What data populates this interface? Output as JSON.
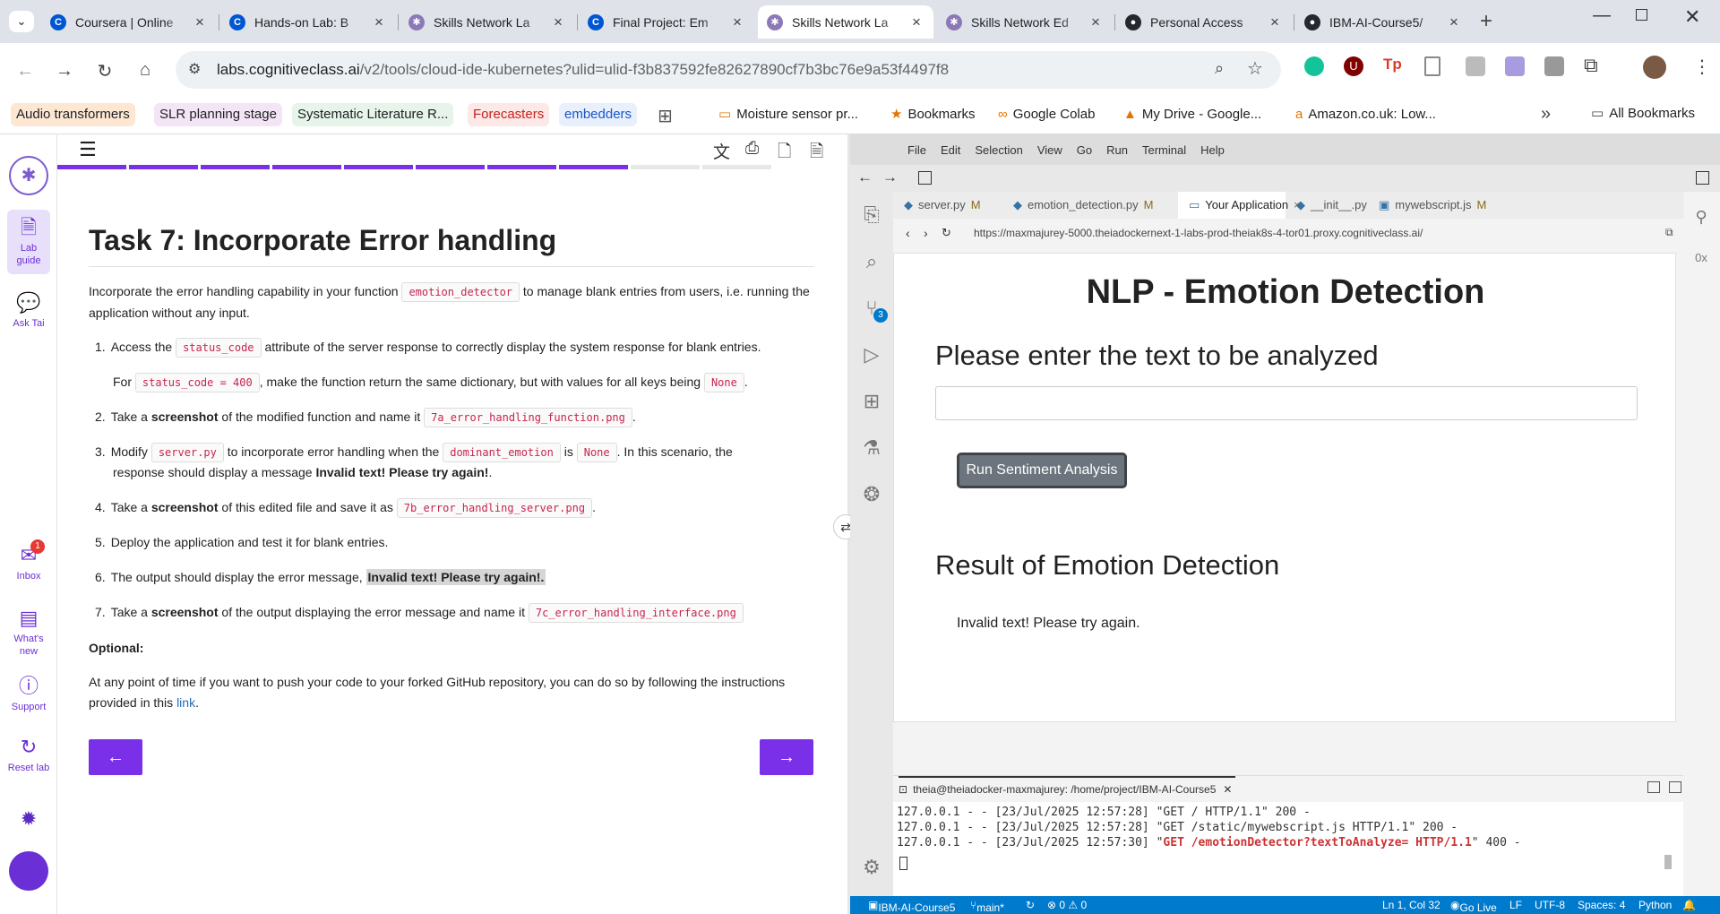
{
  "browser": {
    "tabs": [
      {
        "title": "Coursera | Online",
        "fav": "C",
        "color": "#0056d2"
      },
      {
        "title": "Hands-on Lab: B",
        "fav": "C",
        "color": "#0056d2"
      },
      {
        "title": "Skills Network La",
        "fav": "✱",
        "color": "#8c7ab8"
      },
      {
        "title": "Final Project: Em",
        "fav": "C",
        "color": "#0056d2"
      },
      {
        "title": "Skills Network La",
        "fav": "✱",
        "color": "#8c7ab8"
      },
      {
        "title": "Skills Network Ed",
        "fav": "✱",
        "color": "#8c7ab8"
      },
      {
        "title": "Personal Access",
        "fav": "●",
        "color": "#24292e"
      },
      {
        "title": "IBM-AI-Course5/",
        "fav": "●",
        "color": "#24292e"
      }
    ],
    "new_tab": "+",
    "url_host": "labs.cognitiveclass.ai",
    "url_path": "/v2/tools/cloud-ide-kubernetes?ulid=ulid-f3b837592fe82627890cf7b3bc76e9a53f4497f8",
    "bookmarks_chips": [
      {
        "label": "Audio transformers",
        "bg": "#fde7d3",
        "fg": "#202124"
      },
      {
        "label": "SLR planning stage",
        "bg": "#f3e5f5",
        "fg": "#202124"
      },
      {
        "label": "Systematic Literature R...",
        "bg": "#e6f4ea",
        "fg": "#202124"
      },
      {
        "label": "Forecasters",
        "bg": "#fce8e6",
        "fg": "#c5221f"
      },
      {
        "label": "embedders",
        "bg": "#e8f0fe",
        "fg": "#1a56c2"
      }
    ],
    "bookmarks_plain": [
      "Moisture sensor pr...",
      "Bookmarks",
      "Google Colab",
      "My Drive - Google...",
      "Amazon.co.uk: Low..."
    ],
    "all_bookmarks": "All Bookmarks",
    "more": "»"
  },
  "labside": {
    "lab_guide": "Lab guide",
    "ask_tai": "Ask Tai",
    "inbox": "Inbox",
    "inbox_badge": "1",
    "whats_new": "What's new",
    "support": "Support",
    "reset_lab": "Reset lab"
  },
  "guide": {
    "progress_done": 8,
    "progress_total": 10,
    "title": "Task 7: Incorporate Error handling",
    "intro_a": "Incorporate the error handling capability in your function",
    "intro_code": "emotion_detector",
    "intro_b": "to manage blank entries from users, i.e. running the application without any input.",
    "s1_num": "1.",
    "s1_a": "Access the",
    "s1_code": "status_code",
    "s1_b": "attribute of the server response to correctly display the system response for blank entries.",
    "s1_c": "For",
    "s1_code2": "status_code = 400",
    "s1_d": ", make the function return the same dictionary, but with values for all keys being",
    "s1_code3": "None",
    "s2_num": "2.",
    "s2_a": "Take a",
    "s2_bold": "screenshot",
    "s2_b": "of the modified function and name it",
    "s2_code": "7a_error_handling_function.png",
    "s3_num": "3.",
    "s3_a": "Modify",
    "s3_code": "server.py",
    "s3_b": "to incorporate error handling when the",
    "s3_code2": "dominant_emotion",
    "s3_c": "is",
    "s3_code3": "None",
    "s3_d": ". In this scenario, the",
    "s3_e": "response should display a message",
    "s3_bold": "Invalid text! Please try again!",
    "s4_num": "4.",
    "s4_a": "Take a",
    "s4_bold": "screenshot",
    "s4_b": "of this edited file and save it as",
    "s4_code": "7b_error_handling_server.png",
    "s5_num": "5.",
    "s5_a": "Deploy the application and test it for blank entries.",
    "s6_num": "6.",
    "s6_a": "The output should display the error message,",
    "s6_hl": "Invalid text! Please try again!.",
    "s7_num": "7.",
    "s7_a": "Take a",
    "s7_bold": "screenshot",
    "s7_b": "of the output displaying the error message and name it",
    "s7_code": "7c_error_handling_interface.png",
    "optional": "Optional:",
    "opt_a": "At any point of time if you want to push your code to your forked GitHub repository, you can do so by following the instructions",
    "opt_b": "provided in this",
    "opt_link": "link",
    "prev": "←",
    "next": "→"
  },
  "ide": {
    "menu": [
      "File",
      "Edit",
      "Selection",
      "View",
      "Go",
      "Run",
      "Terminal",
      "Help"
    ],
    "scm_badge": "3",
    "tabs": [
      {
        "label": "server.py",
        "mod": "M"
      },
      {
        "label": "emotion_detection.py",
        "mod": "M"
      },
      {
        "label": "Your Application",
        "mod": "×"
      },
      {
        "label": "__init__.py",
        "mod": ""
      },
      {
        "label": "mywebscript.js",
        "mod": "M"
      }
    ],
    "preview_url": "https://maxmajurey-5000.theiadockernext-1-labs-prod-theiak8s-4-tor01.proxy.cognitiveclass.ai/",
    "app": {
      "h1": "NLP - Emotion Detection",
      "h2": "Please enter the text to be analyzed",
      "button": "Run Sentiment Analysis",
      "h3": "Result of Emotion Detection",
      "result": "Invalid text! Please try again."
    },
    "terminal_tab": "theia@theiadocker-maxmajurey: /home/project/IBM-AI-Course5",
    "terminal": [
      {
        "pre": "127.0.0.1 - - [23/Jul/2025 12:57:28] \"GET / HTTP/1.1\" 200 -",
        "red": "",
        "post": ""
      },
      {
        "pre": "127.0.0.1 - - [23/Jul/2025 12:57:28] \"GET /static/mywebscript.js HTTP/1.1\" 200 -",
        "red": "",
        "post": ""
      },
      {
        "pre": "127.0.0.1 - - [23/Jul/2025 12:57:30] \"",
        "red": "GET /emotionDetector?textToAnalyze= HTTP/1.1",
        "post": "\" 400 -"
      }
    ],
    "status": {
      "repo": "IBM-AI-Course5",
      "branch": "main*",
      "problems": "⊗ 0 ⚠ 0",
      "position": "Ln 1, Col 32",
      "golive": "Go Live",
      "eol": "LF",
      "encoding": "UTF-8",
      "spaces": "Spaces: 4",
      "language": "Python"
    }
  }
}
